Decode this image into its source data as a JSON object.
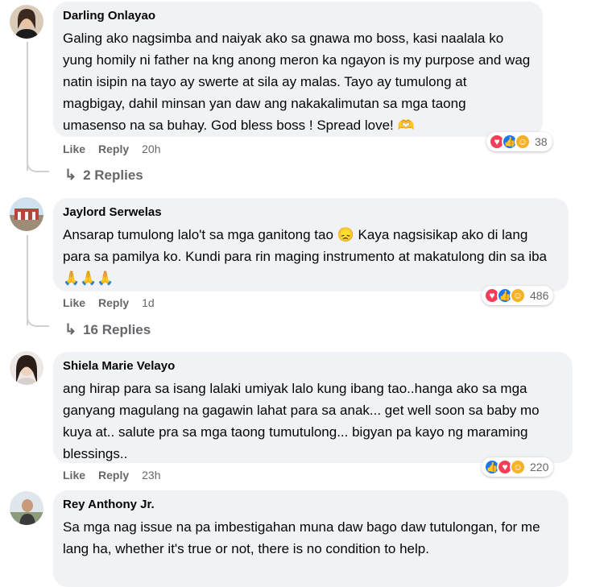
{
  "comments": [
    {
      "author": "Darling Onlayao",
      "text": "Galing ako nagsimba and naiyak ako sa gnawa mo boss, kasi naalala ko yung homily ni father na kng anong meron ka ngayon is my purpose and wag natin isipin na tayo ay swerte at sila ay malas. Tayo ay tumulong at magbigay, dahil minsan yan daw ang nakakalimutan sa mga taong umasenso na sa buhay. God bless boss ! Spread love! 🫶",
      "like_label": "Like",
      "reply_label": "Reply",
      "time": "20h",
      "reaction_count": "38",
      "replies_label": "2 Replies"
    },
    {
      "author": "Jaylord Serwelas",
      "text": "Ansarap tumulong lalo't sa mga ganitong tao 😞 Kaya nagsisikap ako di lang para sa pamilya ko. Kundi para rin maging instrumento at makatulong din sa iba 🙏🙏🙏",
      "like_label": "Like",
      "reply_label": "Reply",
      "time": "1d",
      "reaction_count": "486",
      "replies_label": "16 Replies"
    },
    {
      "author": "Shiela Marie Velayo",
      "text": "ang hirap para sa isang lalaki umiyak lalo kung ibang tao..hanga ako sa mga ganyang magulang na gagawin lahat para sa anak... get well soon sa baby mo kuya at.. salute pra sa mga taong tumutulong... bigyan pa kayo ng maraming blessings..",
      "like_label": "Like",
      "reply_label": "Reply",
      "time": "23h",
      "reaction_count": "220"
    },
    {
      "author": "Rey Anthony Jr.",
      "text": "Sa mga nag issue na pa imbestigahan muna daw bago daw tutulongan, for me lang ha, whether it's true or not, there is no condition to help."
    }
  ],
  "colors": {
    "bubble": "#f0f2f5",
    "meta": "#65676b",
    "love": "#f33e58",
    "like": "#1877f2",
    "care": "#f7b125"
  }
}
